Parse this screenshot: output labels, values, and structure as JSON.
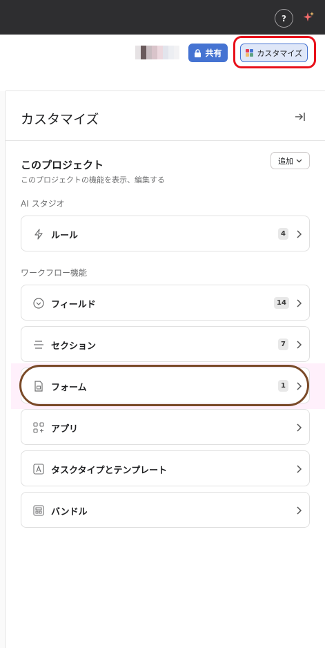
{
  "topbar": {
    "help_label": "?"
  },
  "header": {
    "share_label": "共有",
    "customize_label": "カスタマイズ"
  },
  "panel": {
    "title": "カスタマイズ",
    "project": {
      "title": "このプロジェクト",
      "subtitle": "このプロジェクトの機能を表示、編集する",
      "add_label": "追加"
    },
    "ai_studio": {
      "label": "AI スタジオ",
      "items": [
        {
          "label": "ルール",
          "count": "4",
          "icon": "lightning-icon"
        }
      ]
    },
    "workflow": {
      "label": "ワークフロー機能",
      "items": [
        {
          "label": "フィールド",
          "count": "14",
          "icon": "chevron-circle-icon"
        },
        {
          "label": "セクション",
          "count": "7",
          "icon": "lines-icon"
        },
        {
          "label": "フォーム",
          "count": "1",
          "icon": "form-icon"
        },
        {
          "label": "アプリ",
          "icon": "apps-icon"
        },
        {
          "label": "タスクタイプとテンプレート",
          "icon": "template-icon"
        },
        {
          "label": "バンドル",
          "icon": "bundle-icon"
        }
      ]
    }
  },
  "colors": {
    "topbar": "#2e2e30",
    "accent": "#4573d2",
    "annotation_red": "#e8101a",
    "annotation_brown": "#7a4a28"
  }
}
